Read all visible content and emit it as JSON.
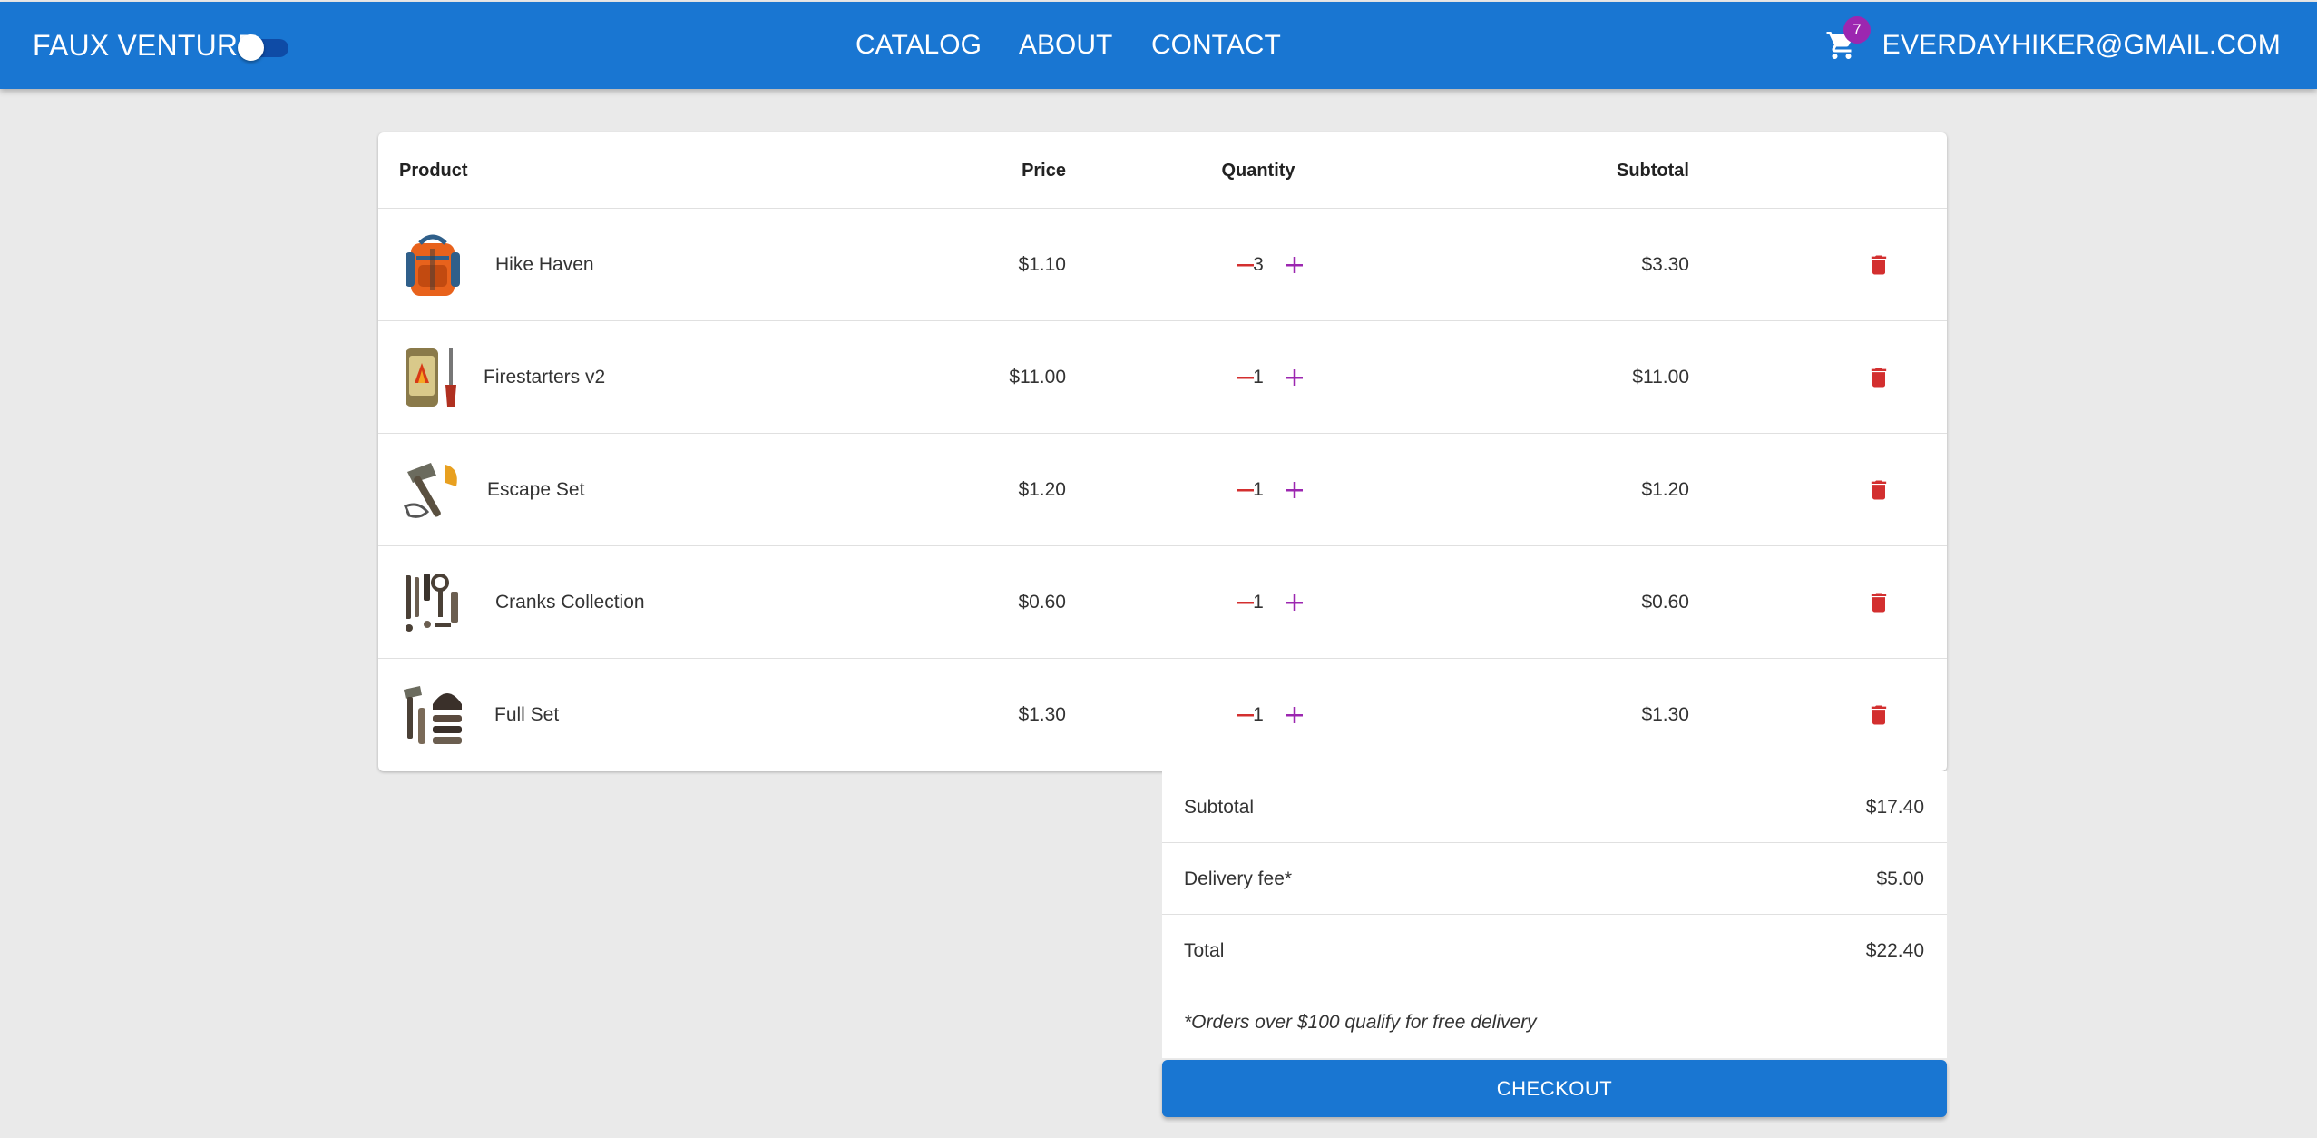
{
  "header": {
    "brand": "FAUX VENTURE",
    "nav": [
      {
        "label": "CATALOG"
      },
      {
        "label": "ABOUT"
      },
      {
        "label": "CONTACT"
      }
    ],
    "cart_count": "7",
    "user_email": "EVERDAYHIKER@GMAIL.COM",
    "theme_toggle_on": false
  },
  "colors": {
    "primary": "#1976d2",
    "badge": "#9c27b0",
    "delete": "#d32f2f",
    "minus": "#d32f2f",
    "plus": "#9c27b0",
    "background": "#eaeaea"
  },
  "table": {
    "headers": {
      "product": "Product",
      "price": "Price",
      "quantity": "Quantity",
      "subtotal": "Subtotal"
    },
    "rows": [
      {
        "name": "Hike Haven",
        "price": "$1.10",
        "qty": "3",
        "subtotal": "$3.30",
        "image_icon": "backpack-icon"
      },
      {
        "name": "Firestarters v2",
        "price": "$11.00",
        "qty": "1",
        "subtotal": "$11.00",
        "image_icon": "firestarter-icon"
      },
      {
        "name": "Escape Set",
        "price": "$1.20",
        "qty": "1",
        "subtotal": "$1.20",
        "image_icon": "hammer-tools-icon"
      },
      {
        "name": "Cranks Collection",
        "price": "$0.60",
        "qty": "1",
        "subtotal": "$0.60",
        "image_icon": "tool-set-icon"
      },
      {
        "name": "Full Set",
        "price": "$1.30",
        "qty": "1",
        "subtotal": "$1.30",
        "image_icon": "gear-set-icon"
      }
    ]
  },
  "summary": {
    "subtotal_label": "Subtotal",
    "subtotal_value": "$17.40",
    "delivery_label": "Delivery fee*",
    "delivery_value": "$5.00",
    "total_label": "Total",
    "total_value": "$22.40",
    "note": "*Orders over $100 qualify for free delivery",
    "checkout_label": "CHECKOUT"
  }
}
